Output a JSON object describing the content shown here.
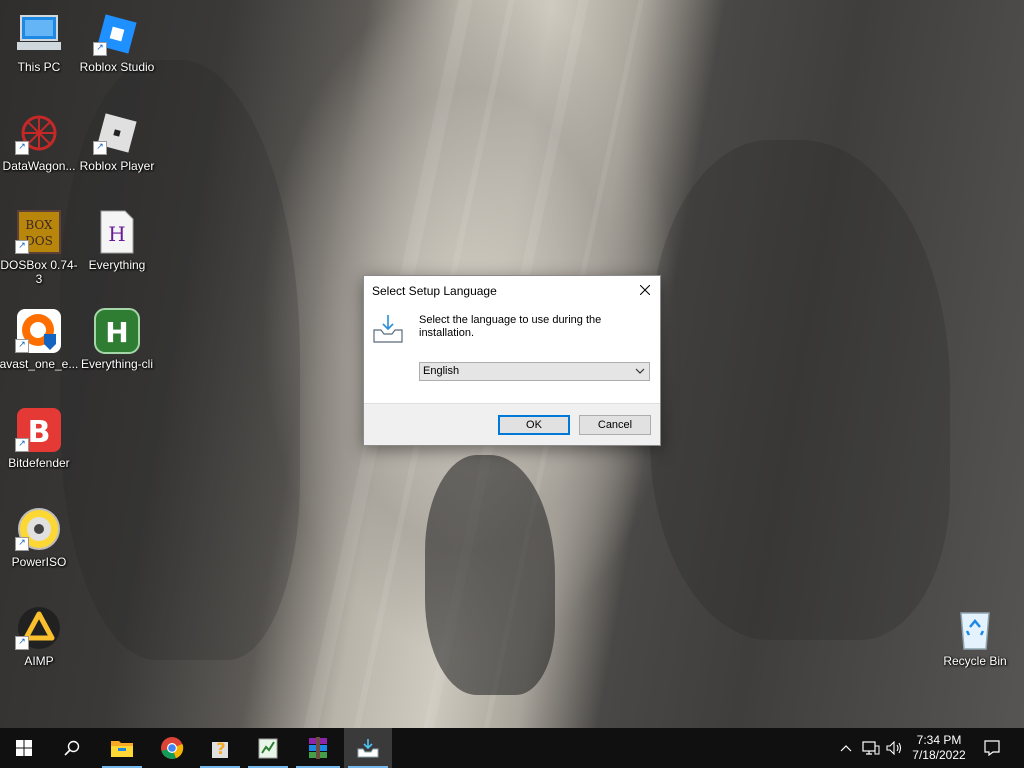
{
  "desktop": {
    "icons": [
      {
        "label": "This PC"
      },
      {
        "label": "Roblox Studio"
      },
      {
        "label": "DataWagon..."
      },
      {
        "label": "Roblox Player"
      },
      {
        "label": "DOSBox 0.74-3"
      },
      {
        "label": "Everything"
      },
      {
        "label": "avast_one_e..."
      },
      {
        "label": "Everything-cli"
      },
      {
        "label": "Bitdefender"
      },
      {
        "label": "PowerISO"
      },
      {
        "label": "AIMP"
      },
      {
        "label": "Recycle Bin"
      }
    ]
  },
  "dialog": {
    "title": "Select Setup Language",
    "message": "Select the language to use during the installation.",
    "language_selected": "English",
    "ok_label": "OK",
    "cancel_label": "Cancel"
  },
  "taskbar": {
    "items": [
      "start-icon",
      "search-icon",
      "file-explorer-icon",
      "chrome-icon",
      "help-icon",
      "notepad-icon",
      "winrar-icon",
      "setup-icon"
    ],
    "clock_time": "7:34 PM",
    "clock_date": "7/18/2022"
  },
  "colors": {
    "accent": "#0078d7",
    "taskbar_bg": "#101010",
    "running_indicator": "#76b9ed"
  }
}
